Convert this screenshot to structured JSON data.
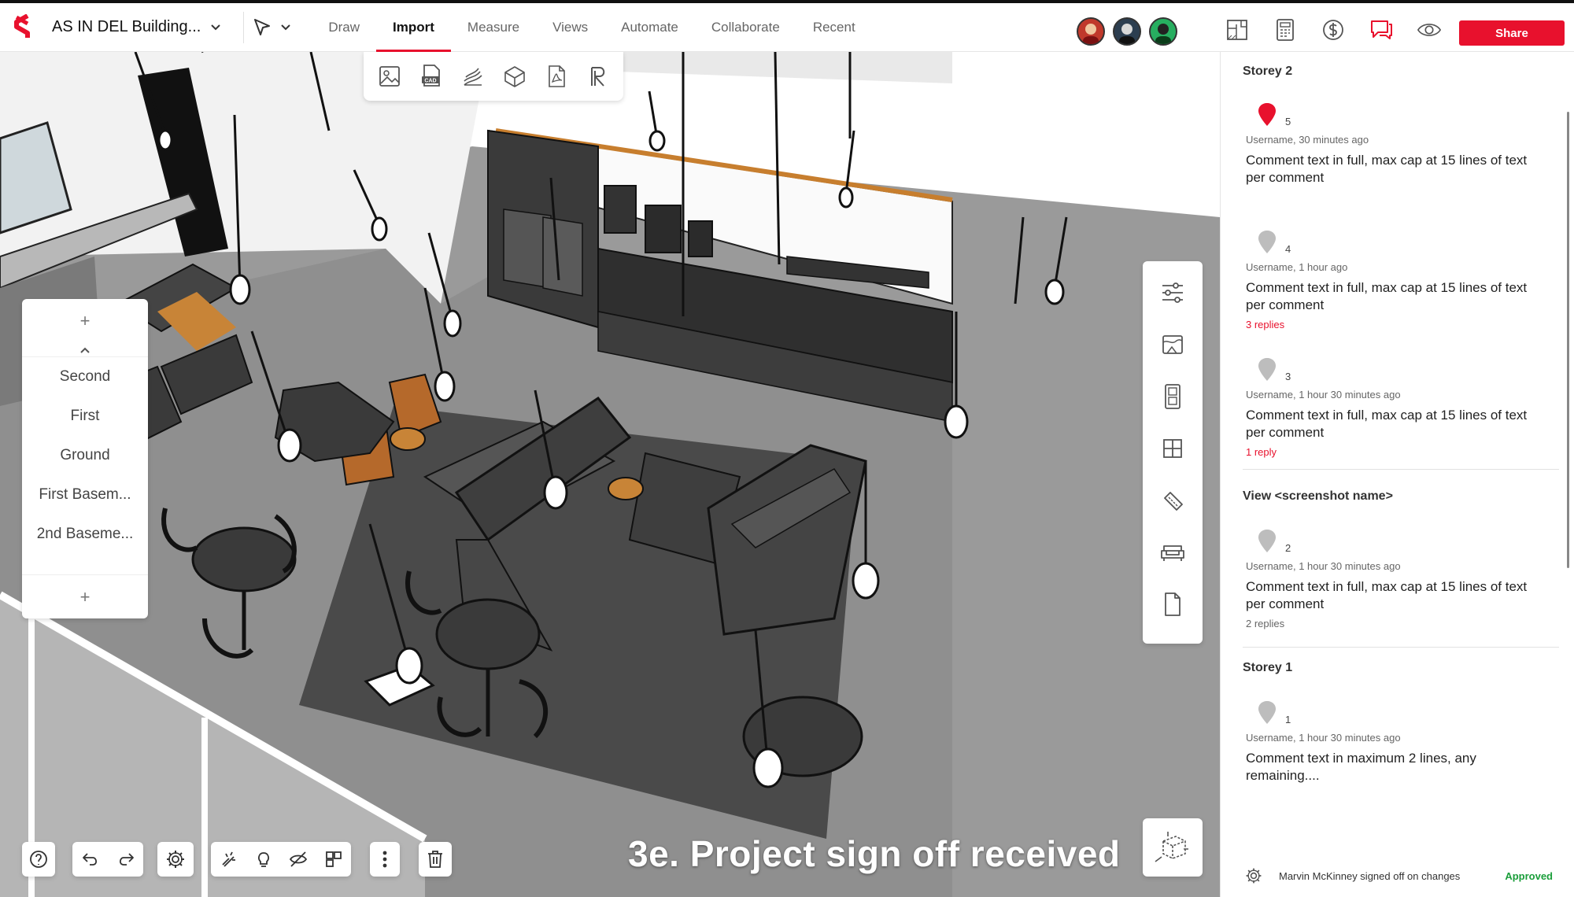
{
  "topbar": {
    "project_name": "AS IN DEL Building...",
    "nav": [
      "Draw",
      "Import",
      "Measure",
      "Views",
      "Automate",
      "Collaborate",
      "Recent"
    ],
    "active_nav": "Import",
    "share_label": "Share",
    "brand_color": "#e8112d",
    "avatar_colors": [
      "#c0392b",
      "#2c3e50",
      "#27ae60"
    ],
    "right_icons": [
      "floorplan-icon",
      "calculator-icon",
      "dollar-icon",
      "comments-icon",
      "eye-icon"
    ]
  },
  "import_tools": [
    "image-icon",
    "cad-icon",
    "terrain-icon",
    "model-icon",
    "pdf-icon",
    "revit-icon"
  ],
  "storeys": {
    "items": [
      "Second",
      "First",
      "Ground",
      "First Basem...",
      "2nd Baseme..."
    ],
    "add_symbol": "+"
  },
  "right_tools": [
    "settings-sliders-icon",
    "materials-icon",
    "door-icon",
    "window-icon",
    "measure-tape-icon",
    "furniture-icon",
    "document-icon"
  ],
  "caption": "3e. Project sign off received",
  "panel": {
    "sections": [
      {
        "title": "Storey 2",
        "comments": [
          {
            "pin": "5",
            "meta": "Username, 30 minutes ago",
            "text": "Comment text in full, max cap at 15 lines of text per comment",
            "replies": "",
            "active": true
          },
          {
            "pin": "4",
            "meta": "Username, 1 hour ago",
            "text": "Comment text in full, max cap at 15 lines of text per comment",
            "replies": "3 replies",
            "active": false
          },
          {
            "pin": "3",
            "meta": "Username, 1 hour 30 minutes ago",
            "text": "Comment text in full, max cap at 15 lines of text per comment",
            "replies": "1 reply",
            "active": false
          }
        ]
      },
      {
        "title": "View <screenshot name>",
        "comments": [
          {
            "pin": "2",
            "meta": "Username, 1 hour 30 minutes ago",
            "text": "Comment text in full, max cap at 15 lines of text per comment",
            "replies": "2 replies",
            "active": false
          }
        ]
      },
      {
        "title": "Storey 1",
        "comments": [
          {
            "pin": "1",
            "meta": "Username, 1 hour 30 minutes ago",
            "text": "Comment text in maximum 2 lines, any remaining....",
            "replies": "",
            "active": false
          }
        ]
      }
    ],
    "signoff_message": "Marvin McKinney signed off on changes",
    "signoff_status": "Approved"
  }
}
